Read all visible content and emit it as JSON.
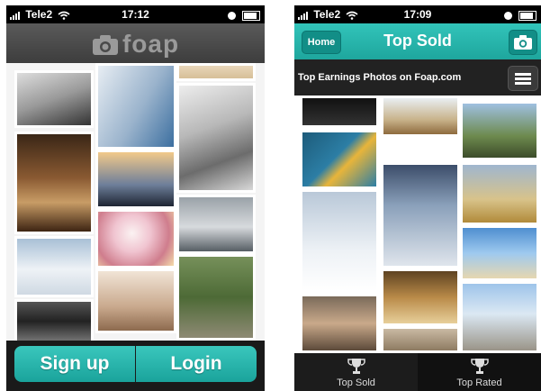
{
  "left_phone": {
    "status": {
      "carrier": "Tele2",
      "time": "17:12"
    },
    "brand": "foap",
    "buttons": {
      "signup": "Sign up",
      "login": "Login"
    }
  },
  "right_phone": {
    "status": {
      "carrier": "Tele2",
      "time": "17:09"
    },
    "header": {
      "home": "Home",
      "title": "Top Sold"
    },
    "subheader": "Top Earnings Photos on Foap.com",
    "tabs": [
      {
        "label": "Top Sold"
      },
      {
        "label": "Top Rated"
      }
    ]
  },
  "colors": {
    "accent": "#25b3aa",
    "dark": "#222222"
  },
  "icons": [
    "camera-icon",
    "menu-icon",
    "trophy-icon",
    "wifi-icon",
    "battery-icon",
    "signal-icon"
  ]
}
